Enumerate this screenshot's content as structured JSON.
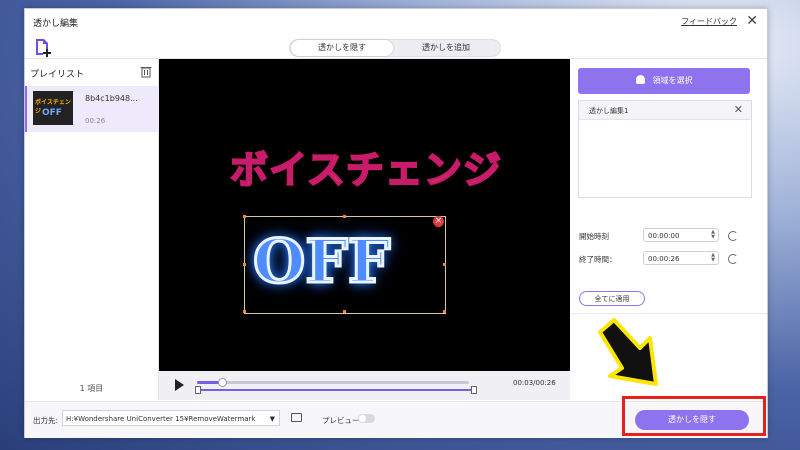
{
  "window": {
    "title": "透かし編集",
    "feedback": "フィードバック"
  },
  "mode_tabs": {
    "active": "透かしを隠す",
    "inactive": "透かしを追加"
  },
  "playlist": {
    "label": "プレイリスト",
    "items": [
      {
        "name": "8b4c1b948...",
        "duration": "00:26",
        "thumb_line1": "ボイスチェンジ",
        "thumb_line2": "OFF"
      }
    ],
    "count": "1 項目"
  },
  "preview": {
    "line1": "ボイスチェンジ",
    "line2": "OFF"
  },
  "player": {
    "time": "00:03/00:26",
    "progress": 0.09
  },
  "right_panel": {
    "select_region": "領域を選択",
    "area_title": "透かし編集1",
    "start_label": "開始時刻",
    "start_value": "00:00:00",
    "end_label": "終了時間：",
    "end_value": "00:00:26",
    "apply_all": "全てに適用"
  },
  "bottom": {
    "output_label": "出力先:",
    "output_path": "H:¥Wondershare UniConverter 15¥RemoveWatermark",
    "preview_label": "プレビュー",
    "remove_button": "透かしを隠す"
  },
  "colors": {
    "accent": "#8f72ee",
    "annotation_red": "#e8201e",
    "arrow_yellow": "#ffe500"
  }
}
